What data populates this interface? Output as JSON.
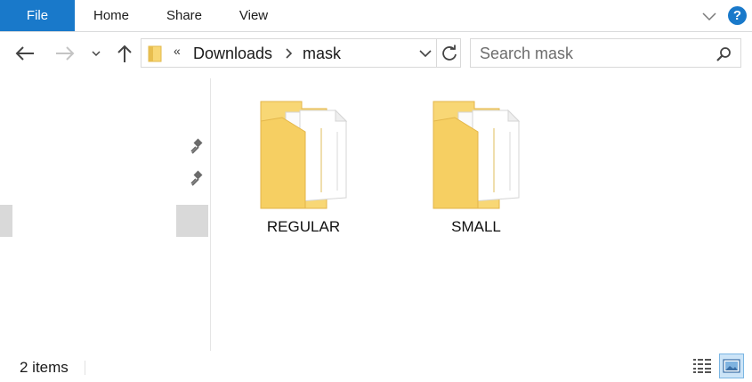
{
  "ribbon": {
    "tabs": [
      {
        "label": "File",
        "active": true
      },
      {
        "label": "Home"
      },
      {
        "label": "Share"
      },
      {
        "label": "View"
      }
    ],
    "help": "?"
  },
  "address": {
    "overflow": "«",
    "crumbs": [
      "Downloads",
      "mask"
    ]
  },
  "search": {
    "placeholder": "Search mask"
  },
  "content": {
    "items": [
      {
        "name": "REGULAR",
        "type": "folder"
      },
      {
        "name": "SMALL",
        "type": "folder"
      }
    ]
  },
  "status": {
    "count_text": "2 items"
  },
  "icons": {
    "back": "back-arrow-icon",
    "forward": "forward-arrow-icon",
    "recent": "chevron-down-icon",
    "up": "up-arrow-icon",
    "refresh": "refresh-icon",
    "search": "search-icon",
    "pin": "pin-icon",
    "details_view": "details-view-icon",
    "large_icons_view": "large-icons-view-icon"
  },
  "colors": {
    "accent": "#1979ca",
    "folder": "#f8d775",
    "view_selected": "#cce4f7"
  }
}
